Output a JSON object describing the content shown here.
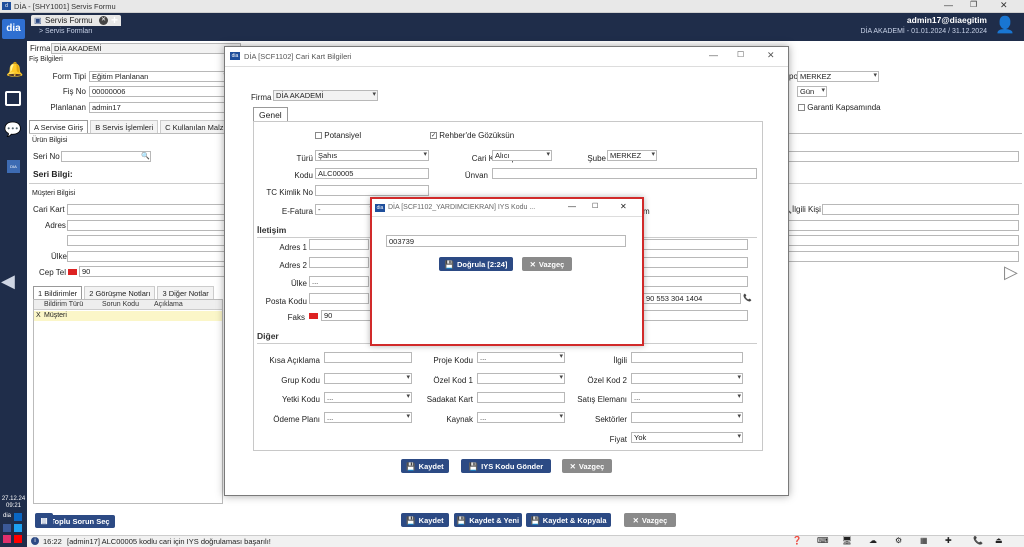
{
  "window_title": "DİA - [SHY1001] Servis Formu",
  "app": {
    "tab_title": "Servis Formu",
    "breadcrumb": "> Servis Formları",
    "user": "admin17@diaegitim",
    "period": "DİA AKADEMİ - 01.01.2024 / 31.12.2024",
    "datetime": "27.12.24",
    "time": "09:21"
  },
  "form": {
    "firma_label": "Firma",
    "firma_value": "DİA AKADEMİ",
    "fis_bilgileri": "Fiş Bilgileri",
    "form_tipi_label": "Form Tipi",
    "form_tipi_value": "Eğitim Planlanan",
    "fis_no_label": "Fiş No",
    "fis_no_value": "00000006",
    "planlanan_label": "Planlanan",
    "planlanan_value": "admin17",
    "depo_label": "po",
    "depo_value": "MERKEZ",
    "gun_value": "Gün",
    "garanti_label": "Garanti Kapsamında",
    "tabs": [
      "A Servise Giriş",
      "B Servis İşlemleri",
      "C Kullanılan Malz"
    ],
    "urun_bilgisi": "Ürün Bilgisi",
    "seri_no_label": "Seri No",
    "seri_bilgi": "Seri Bilgi:",
    "musteri_bilgisi": "Müşteri Bilgisi",
    "cari_kart_label": "Cari Kart",
    "adres_label": "Adres",
    "ulke_label": "Ülke",
    "cep_tel_label": "Cep Tel",
    "cep_tel_value": "90",
    "ilgili_kisi_label": "İlgili Kişi",
    "lower_tabs": [
      "1 Bildirimler",
      "2 Görüşme Notları",
      "3 Diğer Notlar"
    ],
    "grid_headers": [
      "Bildirim Türü",
      "Sorun Kodu",
      "Açıklama"
    ],
    "grid_row": {
      "mark": "X",
      "tur": "Müşteri"
    },
    "toplu_btn": "Toplu Sorun Seç",
    "bottom_buttons": {
      "save": "Kaydet",
      "save_new": "Kaydet & Yeni",
      "save_copy": "Kaydet & Kopyala",
      "cancel": "Vazgeç"
    }
  },
  "dialog": {
    "title": "DİA [SCF1102] Cari Kart Bilgileri",
    "firma_label": "Firma",
    "firma_value": "DİA AKADEMİ",
    "tab_genel": "Genel",
    "potansiyel": "Potansiyel",
    "rehber": "Rehber'de Gözüksün",
    "turu_label": "Türü",
    "turu_value": "Şahıs",
    "cari_kart_tipi_label": "Cari Kart Tipi",
    "cari_kart_tipi_value": "Alıcı",
    "sube_label": "Şube",
    "sube_value": "MERKEZ",
    "kodu_label": "Kodu",
    "kodu_value": "ALC00005",
    "unvan_label": "Ünvan",
    "tc_label": "TC Kimlik No",
    "efatura_label": "E-Fatura",
    "efatura_value": "-",
    "efatura_suffix": "m",
    "iletisim": "İletişim",
    "adres1_label": "Adres 1",
    "adres2_label": "Adres 2",
    "ulke_label": "Ülke",
    "ulke_value": "...",
    "posta_label": "Posta Kodu",
    "tel_value": "90 553 304 1404",
    "faks_label": "Faks",
    "faks_value": "90",
    "diger": "Diğer",
    "kisa_aciklama": "Kısa Açıklama",
    "proje_kodu": "Proje Kodu",
    "proje_value": "...",
    "ilgili": "İlgili",
    "grup_kodu": "Grup Kodu",
    "ozel_kod_1": "Özel Kod 1",
    "ozel_kod_2": "Özel Kod 2",
    "yetki_kodu": "Yetki Kodu",
    "yetki_value": "...",
    "sadakat_kart": "Sadakat Kart",
    "satis_elemani": "Satış Elemanı",
    "satis_value": "...",
    "odeme_plani": "Ödeme Planı",
    "odeme_value": "...",
    "kaynak": "Kaynak",
    "kaynak_value": "...",
    "sektorler": "Sektörler",
    "fiyat": "Fiyat",
    "fiyat_value": "Yok",
    "btn_kaydet": "Kaydet",
    "btn_iys": "IYS Kodu Gönder",
    "btn_vazgec": "Vazgeç"
  },
  "modal": {
    "title": "DİA [SCF1102_YARDIMCIEKRAN] IYS Kodu ...",
    "code_value": "003739",
    "btn_dogrula": "Doğrula [2:24]",
    "btn_vazgec": "Vazgeç"
  },
  "status": {
    "time": "16:22",
    "message": "[admin17] ALC00005 kodlu cari için IYS doğrulaması başarılı!"
  },
  "colors": {
    "accent": "#2c4a84",
    "sidebar": "#1f2d4a",
    "highlight": "#d12a2a"
  }
}
